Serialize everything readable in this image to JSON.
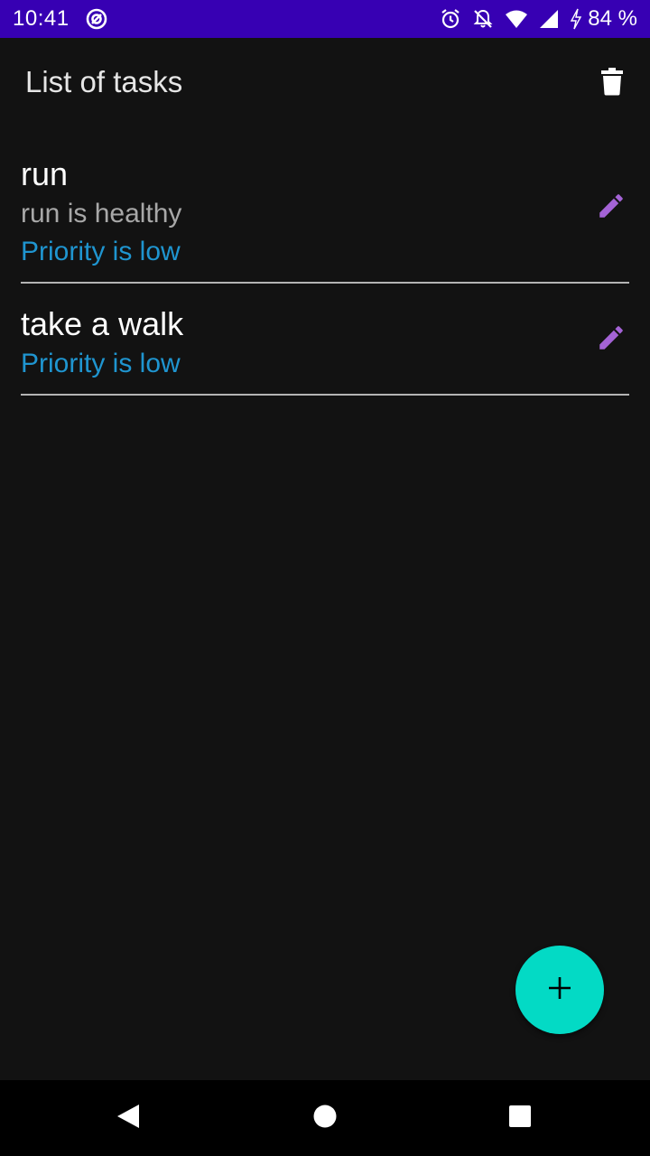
{
  "status_bar": {
    "time": "10:41",
    "battery": "84 %",
    "icons": [
      "sync-icon",
      "alarm-icon",
      "notifications-off-icon",
      "wifi-icon",
      "signal-icon",
      "charging-icon"
    ]
  },
  "app_bar": {
    "title": "List of tasks",
    "delete_icon": "trash-icon"
  },
  "tasks": [
    {
      "title": "run",
      "description": "run is healthy",
      "priority": "Priority is low",
      "edit_icon": "pencil-icon"
    },
    {
      "title": "take a walk",
      "priority": "Priority is low",
      "edit_icon": "pencil-icon"
    }
  ],
  "fab": {
    "icon": "plus-icon"
  },
  "nav_bar": {
    "icons": [
      "back-icon",
      "home-icon",
      "recents-icon"
    ]
  },
  "colors": {
    "status_bar": "#3700b3",
    "background": "#121212",
    "priority_text": "#1f95d0",
    "edit_icon": "#a463d6",
    "fab": "#03dac5"
  }
}
